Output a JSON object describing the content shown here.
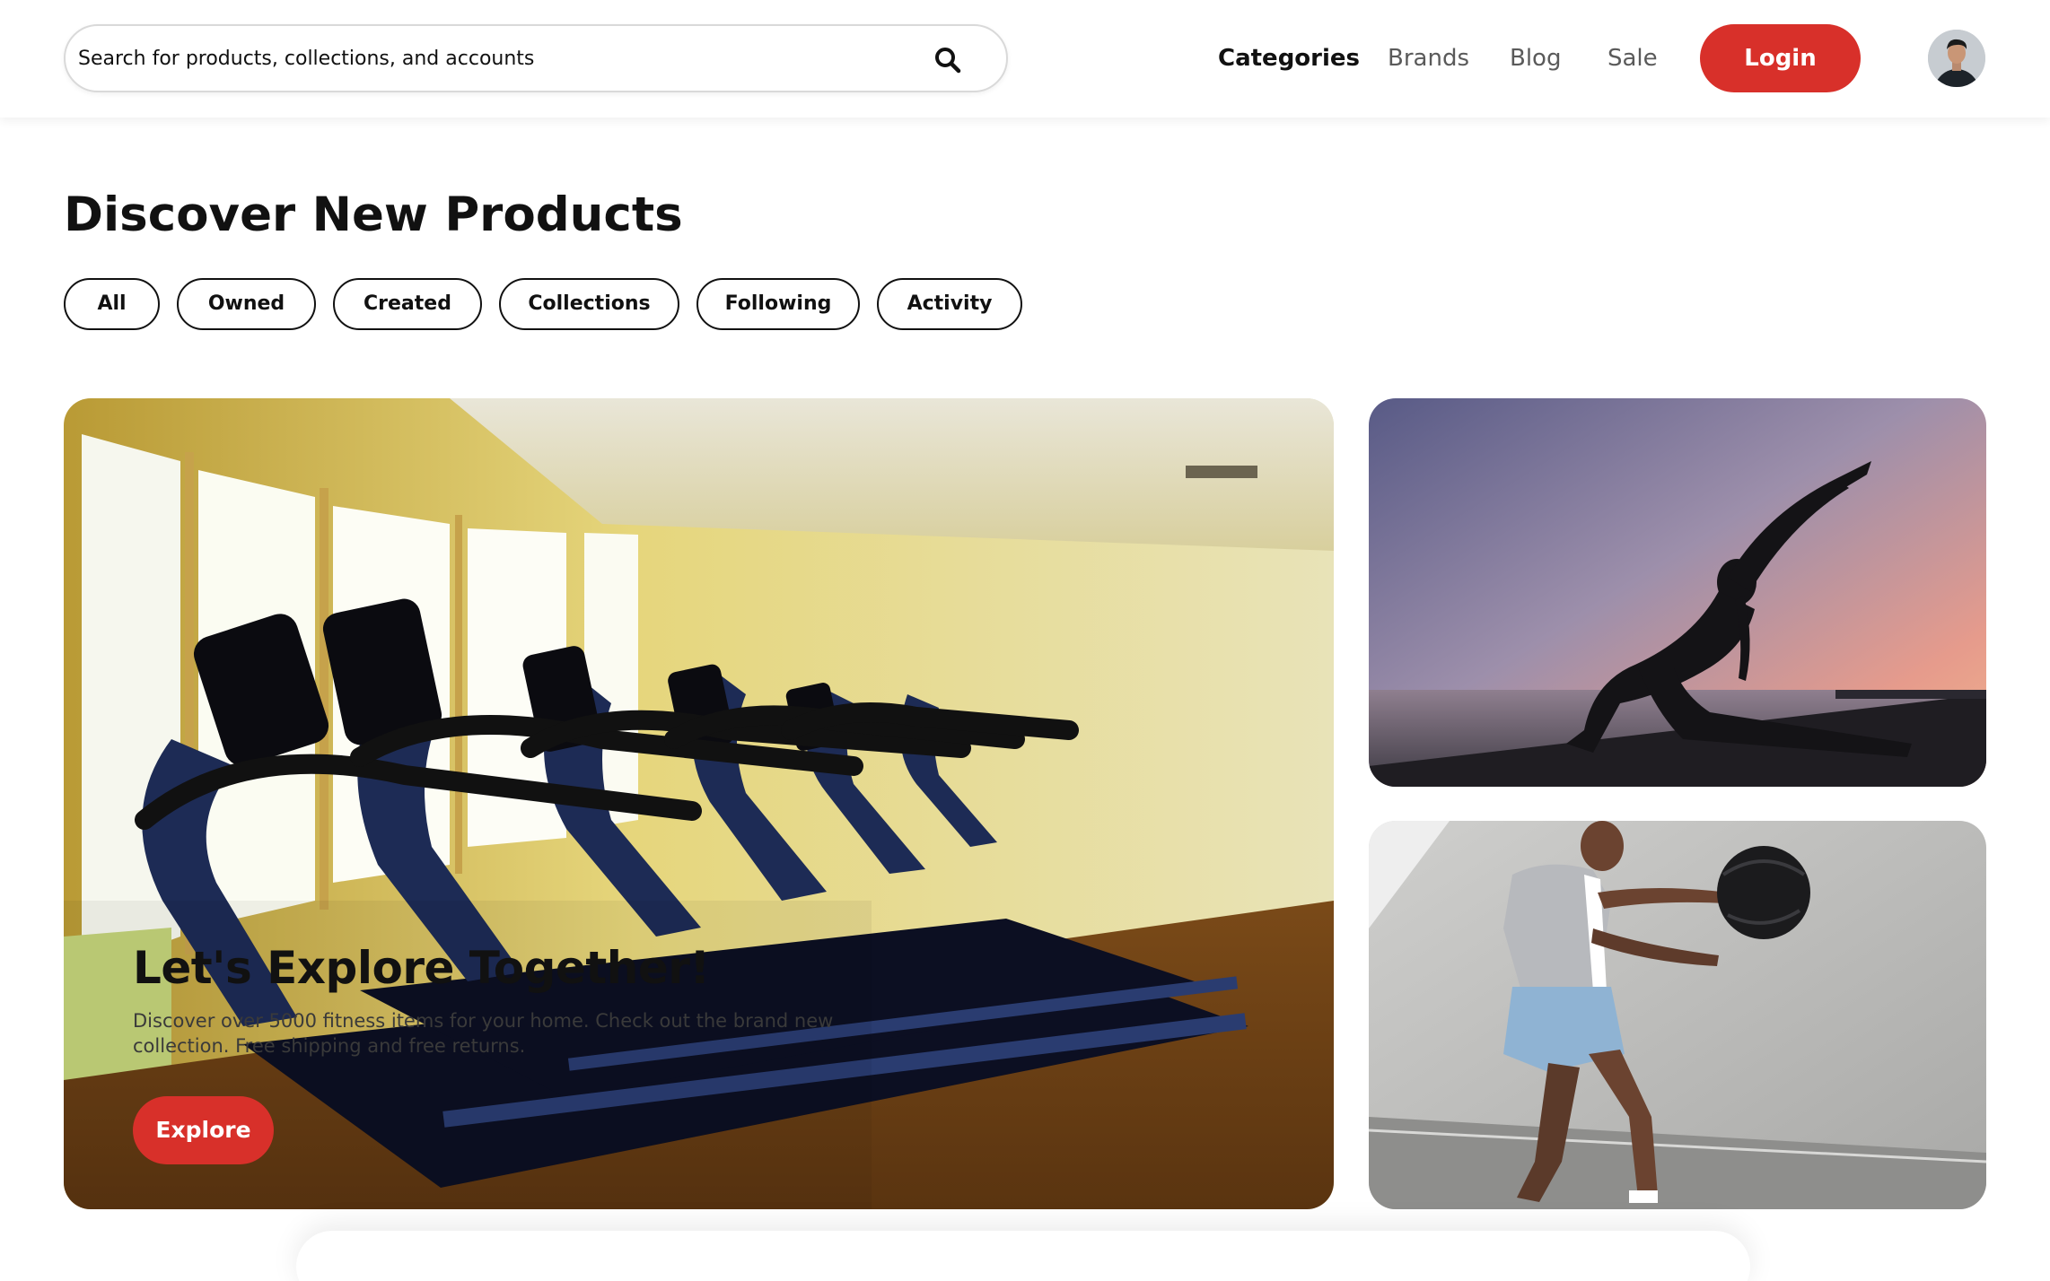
{
  "header": {
    "search": {
      "placeholder": "Search for products, collections, and accounts"
    },
    "nav": [
      {
        "label": "Categories",
        "active": true
      },
      {
        "label": "Brands",
        "active": false
      },
      {
        "label": "Blog",
        "active": false
      },
      {
        "label": "Sale",
        "active": false
      }
    ],
    "login_label": "Login",
    "avatar_icon": "user-avatar"
  },
  "main": {
    "title": "Discover New Products",
    "filters": [
      "All",
      "Owned",
      "Created",
      "Collections",
      "Following",
      "Activity"
    ],
    "hero": {
      "title": "Let's Explore Together!",
      "description": "Discover over 5000 fitness items for your home. Check out the brand new collection. Free shipping and free returns.",
      "cta_label": "Explore",
      "image": "treadmills-gym-photo"
    },
    "side_cards": [
      {
        "image": "yoga-sunset-photo"
      },
      {
        "image": "medicine-ball-workout-photo"
      }
    ]
  },
  "colors": {
    "accent": "#d8302a",
    "text": "#111111",
    "muted": "#5a5a5a"
  }
}
